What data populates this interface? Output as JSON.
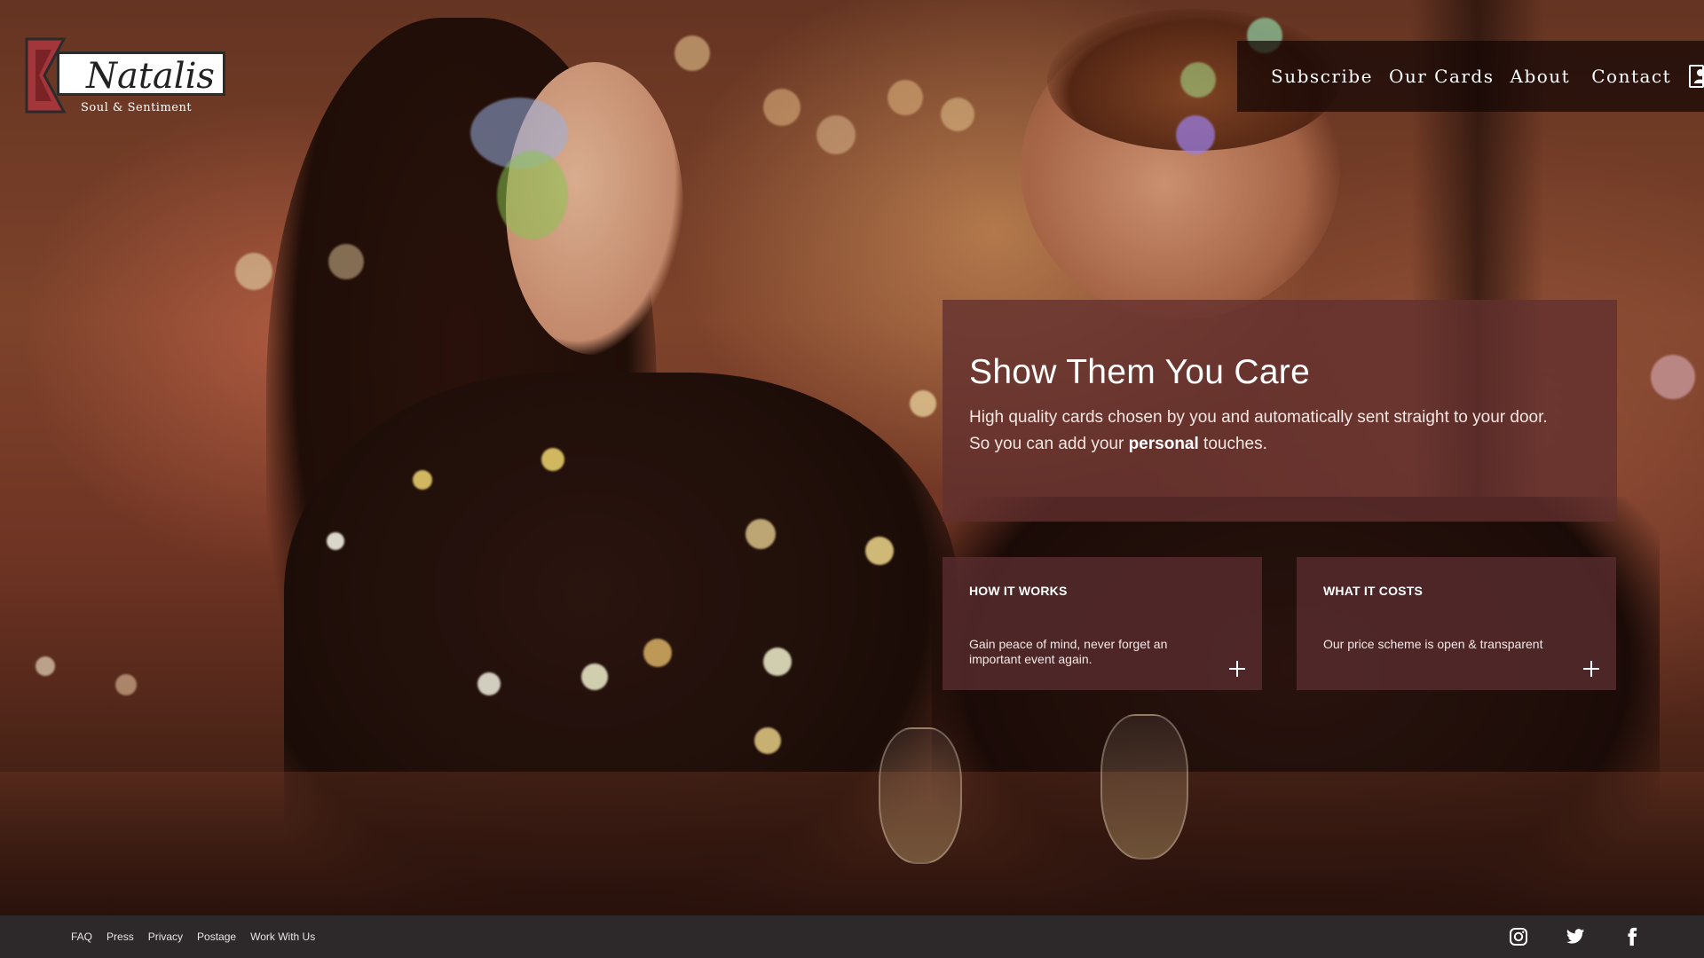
{
  "brand": {
    "name": "Natalis",
    "tagline": "Soul & Sentiment",
    "colors": {
      "accent": "#a3363b",
      "dark": "#2d2a2a"
    }
  },
  "nav": {
    "items": [
      {
        "label": "Subscribe"
      },
      {
        "label": "Our Cards"
      },
      {
        "label": "About"
      },
      {
        "label": "Contact"
      }
    ],
    "account_icon": "user-icon"
  },
  "hero": {
    "title": "Show Them You Care",
    "line1": "High quality cards chosen by you and automatically sent straight to your door.",
    "line2_pre": "So you can add your ",
    "line2_bold": "personal",
    "line2_post": " touches."
  },
  "cards": [
    {
      "title": "HOW IT WORKS",
      "text": "Gain peace of mind, never forget an important event again.",
      "expand_icon": "plus-icon"
    },
    {
      "title": "WHAT IT COSTS",
      "text": "Our price scheme is open & transparent",
      "expand_icon": "plus-icon"
    }
  ],
  "footer": {
    "links": [
      {
        "label": "FAQ"
      },
      {
        "label": "Press"
      },
      {
        "label": "Privacy"
      },
      {
        "label": "Postage"
      },
      {
        "label": "Work With Us"
      }
    ],
    "social": [
      "instagram-icon",
      "twitter-icon",
      "facebook-icon"
    ],
    "background": "#2d2829"
  }
}
